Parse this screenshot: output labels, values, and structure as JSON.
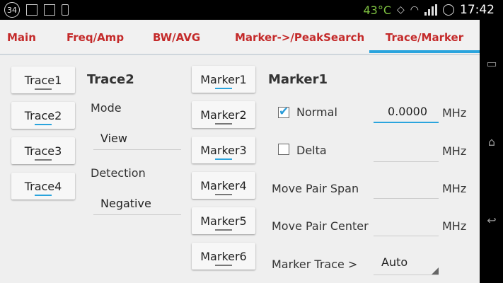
{
  "status": {
    "badge": "34",
    "temperature": "43°C",
    "clock": "17:42"
  },
  "tabs": [
    {
      "label": "Main"
    },
    {
      "label": "Freq/Amp"
    },
    {
      "label": "BW/AVG"
    },
    {
      "label": "Marker->/PeakSearch"
    },
    {
      "label": "Trace/Marker"
    }
  ],
  "traces": [
    {
      "label": "Trace1",
      "selected": false
    },
    {
      "label": "Trace2",
      "selected": true
    },
    {
      "label": "Trace3",
      "selected": false
    },
    {
      "label": "Trace4",
      "selected": true
    }
  ],
  "trace_panel": {
    "title": "Trace2",
    "mode_label": "Mode",
    "mode_value": "View",
    "detection_label": "Detection",
    "detection_value": "Negative"
  },
  "markers": [
    {
      "label": "Marker1",
      "selected": true
    },
    {
      "label": "Marker2",
      "selected": false
    },
    {
      "label": "Marker3",
      "selected": true
    },
    {
      "label": "Marker4",
      "selected": false
    },
    {
      "label": "Marker5",
      "selected": false
    },
    {
      "label": "Marker6",
      "selected": false
    }
  ],
  "marker_panel": {
    "title": "Marker1",
    "normal_label": "Normal",
    "normal_checked": true,
    "normal_value": "0.0000",
    "delta_label": "Delta",
    "delta_checked": false,
    "move_pair_span_label": "Move Pair Span",
    "move_pair_center_label": "Move Pair Center",
    "marker_trace_label": "Marker Trace >",
    "marker_trace_value": "Auto",
    "unit": "MHz"
  },
  "colors": {
    "accent": "#2aa4dd",
    "tab_text": "#c42a2a",
    "temperature": "#7fc241"
  }
}
